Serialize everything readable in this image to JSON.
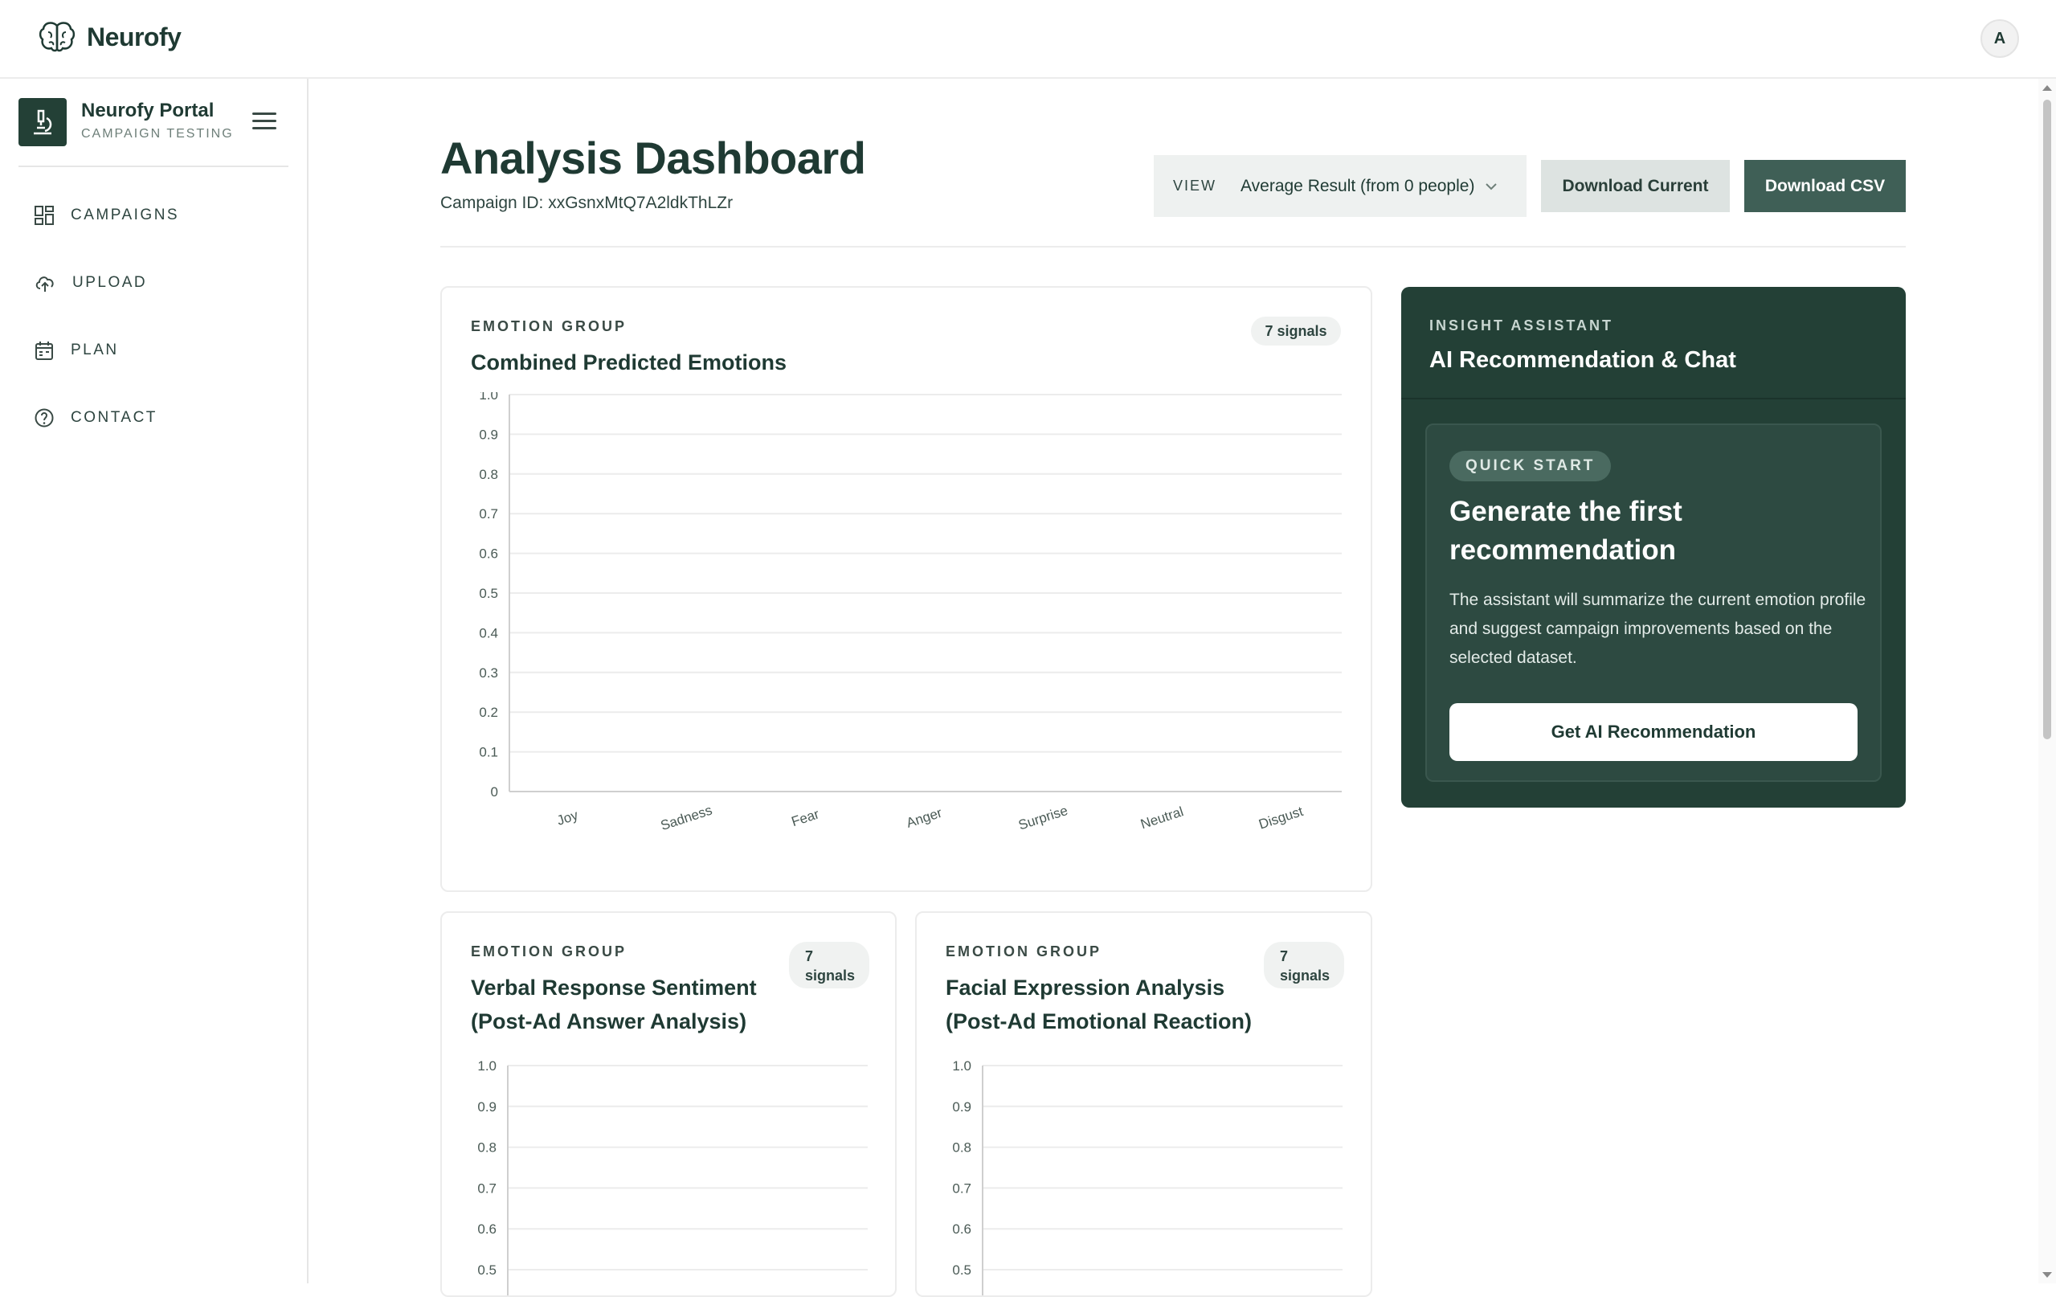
{
  "app": {
    "name": "Neurofy",
    "avatar_initial": "A"
  },
  "sidebar": {
    "portal_name": "Neurofy Portal",
    "portal_sub": "CAMPAIGN TESTING",
    "items": [
      {
        "label": "CAMPAIGNS",
        "icon": "grid-icon"
      },
      {
        "label": "UPLOAD",
        "icon": "cloud-upload-icon"
      },
      {
        "label": "PLAN",
        "icon": "calendar-icon"
      },
      {
        "label": "CONTACT",
        "icon": "help-circle-icon"
      }
    ]
  },
  "header": {
    "title": "Analysis Dashboard",
    "campaign_id": "Campaign ID: xxGsnxMtQ7A2ldkThLZr",
    "view_label": "VIEW",
    "view_value": "Average Result (from 0 people)",
    "download_current": "Download Current",
    "download_csv": "Download CSV"
  },
  "cards": [
    {
      "eyebrow": "EMOTION GROUP",
      "title": "Combined Predicted Emotions",
      "badge": "7 signals"
    },
    {
      "eyebrow": "EMOTION GROUP",
      "title_line1": "Verbal Response Sentiment",
      "title_line2": "(Post-Ad Answer Analysis)",
      "badge_line1": "7",
      "badge_line2": "signals"
    },
    {
      "eyebrow": "EMOTION GROUP",
      "title_line1": "Facial Expression Analysis",
      "title_line2": "(Post-Ad Emotional Reaction)",
      "badge_line1": "7",
      "badge_line2": "signals"
    }
  ],
  "insight": {
    "eyebrow": "INSIGHT ASSISTANT",
    "title": "AI Recommendation & Chat",
    "quick_start": "QUICK START",
    "headline": "Generate the first recommendation",
    "body": "The assistant will summarize the current emotion profile and suggest campaign improvements based on the selected dataset.",
    "button": "Get AI Recommendation"
  },
  "chart_data": [
    {
      "type": "bar",
      "categories": [
        "Joy",
        "Sadness",
        "Fear",
        "Anger",
        "Surprise",
        "Neutral",
        "Disgust"
      ],
      "values": [
        0,
        0,
        0,
        0,
        0,
        0,
        0
      ],
      "title": "Combined Predicted Emotions",
      "yticks": [
        "0",
        "0.1",
        "0.2",
        "0.3",
        "0.4",
        "0.5",
        "0.6",
        "0.7",
        "0.8",
        "0.9",
        "1.0"
      ],
      "ylim": [
        0,
        1.0
      ],
      "grid": true
    },
    {
      "type": "bar",
      "title": "Verbal Response Sentiment (Post-Ad Answer Analysis)",
      "yticks": [
        "0.5",
        "0.6",
        "0.7",
        "0.8",
        "0.9",
        "1.0"
      ],
      "ylim": [
        0,
        1.0
      ],
      "grid": true
    },
    {
      "type": "bar",
      "title": "Facial Expression Analysis (Post-Ad Emotional Reaction)",
      "yticks": [
        "0.5",
        "0.6",
        "0.7",
        "0.8",
        "0.9",
        "1.0"
      ],
      "ylim": [
        0,
        1.0
      ],
      "grid": true
    }
  ]
}
